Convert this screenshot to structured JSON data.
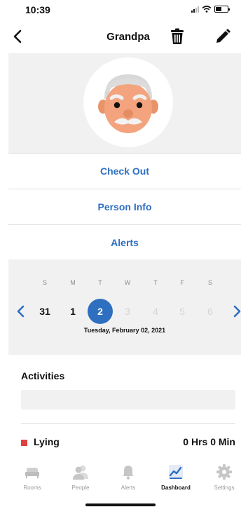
{
  "status": {
    "time": "10:39"
  },
  "header": {
    "title": "Grandpa"
  },
  "menu": [
    "Check Out",
    "Person Info",
    "Alerts"
  ],
  "calendar": {
    "weekdays": [
      "S",
      "M",
      "T",
      "W",
      "T",
      "F",
      "S"
    ],
    "days": [
      "31",
      "1",
      "2",
      "3",
      "4",
      "5",
      "6"
    ],
    "selected_date": "Tuesday, February 02, 2021"
  },
  "activities": {
    "title": "Activities",
    "items": [
      {
        "label": "Lying",
        "value": "0 Hrs 0 Min",
        "color": "#e04040"
      }
    ]
  },
  "tabs": [
    {
      "label": "Rooms",
      "icon": "bed-icon"
    },
    {
      "label": "People",
      "icon": "people-icon"
    },
    {
      "label": "Alerts",
      "icon": "bell-icon"
    },
    {
      "label": "Dashboard",
      "icon": "chart-icon"
    },
    {
      "label": "Settings",
      "icon": "gear-icon"
    }
  ],
  "colors": {
    "accent": "#2f6fc0",
    "panel": "#f1f1f1",
    "lying": "#e04040"
  }
}
